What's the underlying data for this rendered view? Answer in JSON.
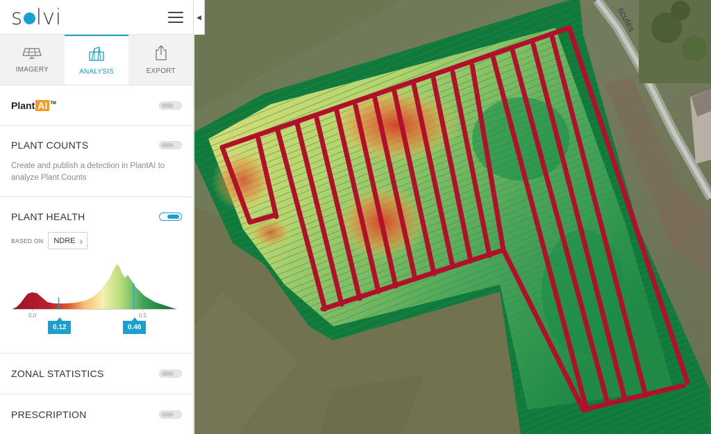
{
  "app": {
    "logo_text_before": "s",
    "logo_text_after": "lvi"
  },
  "tabs": [
    {
      "label": "IMAGERY",
      "icon": "solar-panel-icon",
      "active": false
    },
    {
      "label": "ANALYSIS",
      "icon": "analysis-icon",
      "active": true
    },
    {
      "label": "EXPORT",
      "icon": "export-icon",
      "active": false
    }
  ],
  "plantai": {
    "brand_plant": "Plant",
    "brand_ai": "AI",
    "tm": "TM",
    "enabled": false
  },
  "plant_counts": {
    "title": "PLANT COUNTS",
    "enabled": false,
    "description": "Create and publish a detection in PlantAI to analyze Plant Counts"
  },
  "plant_health": {
    "title": "PLANT HEALTH",
    "enabled": true,
    "based_on_label": "BASED ON",
    "index": "NDRE",
    "axis_ticks": [
      "0.0",
      "0.5"
    ],
    "range_low": "0.12",
    "range_high": "0.46"
  },
  "zonal_statistics": {
    "title": "ZONAL STATISTICS",
    "enabled": false
  },
  "prescription": {
    "title": "PRESCRIPTION",
    "enabled": false
  },
  "map": {
    "road_label": "scufès"
  },
  "colors": {
    "accent": "#1b9fd0",
    "plantai_orange": "#f39a1f",
    "health_low": "#b5102a",
    "health_high": "#0c7a3c"
  }
}
